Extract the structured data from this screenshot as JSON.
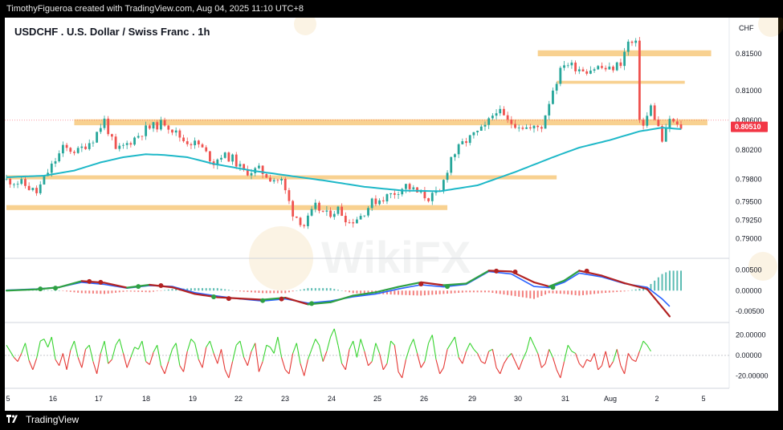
{
  "header": {
    "text": "TimothyFigueroa created with TradingView.com, Aug 04, 2025 11:10 UTC+8"
  },
  "footer": {
    "brand": "TradingView"
  },
  "watermark": {
    "text": "WikiFX"
  },
  "colors": {
    "up": "#26a69a",
    "down": "#ef5350",
    "ma": "#1eb8c8",
    "zone": "#f7c97c",
    "macd_fast": "#2962ff",
    "macd_signal_up": "#2ea043",
    "macd_signal_down": "#b22222",
    "rsi_up": "#38d430",
    "rsi_down": "#e53935",
    "price_badge": "#f23645"
  },
  "chart_data": {
    "type": "candlestick",
    "title": "USDCHF . U.S. Dollar / Swiss Franc . 1h",
    "currency": "CHF",
    "x_ticks": [
      "5",
      "16",
      "17",
      "18",
      "19",
      "22",
      "23",
      "24",
      "25",
      "26",
      "29",
      "30",
      "31",
      "Aug",
      "2",
      "5"
    ],
    "price_axis": {
      "ticks": [
        "0.81500",
        "0.81000",
        "0.80600",
        "0.80200",
        "0.79800",
        "0.79500",
        "0.79250",
        "0.79000"
      ],
      "ylim": [
        0.7882,
        0.819
      ]
    },
    "current_price": "0.80510",
    "price_path": [
      [
        0,
        0.798
      ],
      [
        5,
        0.7975
      ],
      [
        9,
        0.7962
      ],
      [
        12,
        0.799
      ],
      [
        16,
        0.8022
      ],
      [
        20,
        0.8018
      ],
      [
        24,
        0.8035
      ],
      [
        27,
        0.806
      ],
      [
        30,
        0.8018
      ],
      [
        33,
        0.8028
      ],
      [
        38,
        0.8048
      ],
      [
        43,
        0.8057
      ],
      [
        48,
        0.8033
      ],
      [
        52,
        0.8027
      ],
      [
        56,
        0.8003
      ],
      [
        58,
        0.8013
      ],
      [
        61,
        0.8008
      ],
      [
        64,
        0.799
      ],
      [
        68,
        0.7993
      ],
      [
        71,
        0.7982
      ],
      [
        74,
        0.7978
      ],
      [
        77,
        0.7935
      ],
      [
        80,
        0.7918
      ],
      [
        83,
        0.7943
      ],
      [
        86,
        0.7932
      ],
      [
        89,
        0.794
      ],
      [
        92,
        0.7922
      ],
      [
        95,
        0.7931
      ],
      [
        98,
        0.7949
      ],
      [
        101,
        0.7955
      ],
      [
        104,
        0.7962
      ],
      [
        107,
        0.7972
      ],
      [
        110,
        0.7962
      ],
      [
        113,
        0.7955
      ],
      [
        116,
        0.7962
      ],
      [
        119,
        0.801
      ],
      [
        122,
        0.8028
      ],
      [
        125,
        0.804
      ],
      [
        128,
        0.805
      ],
      [
        131,
        0.8075
      ],
      [
        134,
        0.8058
      ],
      [
        137,
        0.8054
      ],
      [
        140,
        0.8048
      ],
      [
        143,
        0.8052
      ],
      [
        146,
        0.8102
      ],
      [
        149,
        0.8138
      ],
      [
        152,
        0.8132
      ],
      [
        155,
        0.8128
      ],
      [
        158,
        0.8132
      ],
      [
        161,
        0.8128
      ],
      [
        164,
        0.8138
      ],
      [
        166,
        0.8165
      ],
      [
        168,
        0.8162
      ],
      [
        169,
        0.8065
      ],
      [
        170,
        0.8052
      ],
      [
        172,
        0.8078
      ],
      [
        174,
        0.805
      ],
      [
        175,
        0.8032
      ],
      [
        176,
        0.8045
      ],
      [
        177,
        0.8062
      ],
      [
        179,
        0.8051
      ]
    ],
    "ma_path": [
      [
        0,
        0.7983
      ],
      [
        10,
        0.7985
      ],
      [
        18,
        0.7992
      ],
      [
        25,
        0.8003
      ],
      [
        31,
        0.801
      ],
      [
        37,
        0.8014
      ],
      [
        42,
        0.8013
      ],
      [
        48,
        0.801
      ],
      [
        55,
        0.8001
      ],
      [
        65,
        0.7992
      ],
      [
        75,
        0.7985
      ],
      [
        85,
        0.7978
      ],
      [
        95,
        0.797
      ],
      [
        105,
        0.7965
      ],
      [
        115,
        0.7964
      ],
      [
        125,
        0.7972
      ],
      [
        135,
        0.799
      ],
      [
        145,
        0.801
      ],
      [
        152,
        0.8023
      ],
      [
        160,
        0.8033
      ],
      [
        168,
        0.8045
      ],
      [
        174,
        0.805
      ],
      [
        179,
        0.8048
      ]
    ],
    "zones": [
      {
        "x0": 141,
        "x1": 187,
        "y_top": 0.81545,
        "y_bot": 0.81465
      },
      {
        "x0": 146,
        "x1": 180,
        "y_top": 0.81133,
        "y_bot": 0.81093
      },
      {
        "x0": 18,
        "x1": 186,
        "y_top": 0.80612,
        "y_bot": 0.80532
      },
      {
        "x0": 0,
        "x1": 146,
        "y_top": 0.79855,
        "y_bot": 0.798
      },
      {
        "x0": 0,
        "x1": 117,
        "y_top": 0.79452,
        "y_bot": 0.79386
      }
    ],
    "macd": {
      "axis_ticks": [
        "0.00500",
        "0.00000",
        "-0.00500"
      ],
      "ylim": [
        -0.0069,
        0.007
      ],
      "fast_path": [
        [
          0,
          0.0001
        ],
        [
          8,
          0.0004
        ],
        [
          14,
          0.0008
        ],
        [
          20,
          0.002
        ],
        [
          26,
          0.0015
        ],
        [
          32,
          0.0006
        ],
        [
          38,
          0.0012
        ],
        [
          44,
          0.001
        ],
        [
          50,
          -0.0005
        ],
        [
          56,
          -0.0013
        ],
        [
          62,
          -0.002
        ],
        [
          68,
          -0.0025
        ],
        [
          74,
          -0.002
        ],
        [
          80,
          -0.003
        ],
        [
          86,
          -0.0025
        ],
        [
          92,
          -0.0015
        ],
        [
          98,
          -0.0008
        ],
        [
          104,
          0.0004
        ],
        [
          110,
          0.0014
        ],
        [
          116,
          0.0009
        ],
        [
          122,
          0.0015
        ],
        [
          128,
          0.0046
        ],
        [
          134,
          0.004
        ],
        [
          140,
          0.001
        ],
        [
          144,
          0.0007
        ],
        [
          148,
          0.002
        ],
        [
          152,
          0.0042
        ],
        [
          158,
          0.0033
        ],
        [
          164,
          0.0017
        ],
        [
          170,
          0.0008
        ],
        [
          174,
          -0.002
        ],
        [
          176,
          -0.0038
        ]
      ],
      "signal_path": [
        [
          0,
          0.0
        ],
        [
          8,
          0.0003
        ],
        [
          14,
          0.0008
        ],
        [
          20,
          0.0023
        ],
        [
          26,
          0.0019
        ],
        [
          32,
          0.0007
        ],
        [
          38,
          0.0014
        ],
        [
          44,
          0.0008
        ],
        [
          50,
          -0.0008
        ],
        [
          56,
          -0.0016
        ],
        [
          62,
          -0.0019
        ],
        [
          68,
          -0.0022
        ],
        [
          74,
          -0.0017
        ],
        [
          80,
          -0.0033
        ],
        [
          86,
          -0.0028
        ],
        [
          92,
          -0.0012
        ],
        [
          98,
          -0.0004
        ],
        [
          104,
          0.0009
        ],
        [
          110,
          0.002
        ],
        [
          116,
          0.0013
        ],
        [
          122,
          0.0017
        ],
        [
          128,
          0.0048
        ],
        [
          134,
          0.0046
        ],
        [
          140,
          0.002
        ],
        [
          144,
          0.001
        ],
        [
          148,
          0.0024
        ],
        [
          152,
          0.0048
        ],
        [
          158,
          0.0036
        ],
        [
          164,
          0.0018
        ],
        [
          170,
          0.0004
        ],
        [
          174,
          -0.004
        ],
        [
          176,
          -0.0062
        ]
      ],
      "dots": [
        {
          "x": 9,
          "v": 0.0004,
          "c": "up"
        },
        {
          "x": 13,
          "v": 0.0006,
          "c": "up"
        },
        {
          "x": 22,
          "v": 0.0022,
          "c": "down"
        },
        {
          "x": 25,
          "v": 0.002,
          "c": "down"
        },
        {
          "x": 35,
          "v": 0.001,
          "c": "up"
        },
        {
          "x": 41,
          "v": 0.0012,
          "c": "down"
        },
        {
          "x": 55,
          "v": -0.0015,
          "c": "up"
        },
        {
          "x": 59,
          "v": -0.0019,
          "c": "down"
        },
        {
          "x": 68,
          "v": -0.0024,
          "c": "up"
        },
        {
          "x": 73,
          "v": -0.002,
          "c": "down"
        },
        {
          "x": 81,
          "v": -0.0031,
          "c": "up"
        },
        {
          "x": 110,
          "v": 0.0016,
          "c": "down"
        },
        {
          "x": 117,
          "v": 0.001,
          "c": "up"
        },
        {
          "x": 130,
          "v": 0.0047,
          "c": "down"
        },
        {
          "x": 135,
          "v": 0.0045,
          "c": "down"
        },
        {
          "x": 145,
          "v": 0.0008,
          "c": "up"
        },
        {
          "x": 154,
          "v": 0.0047,
          "c": "down"
        }
      ]
    },
    "rsi": {
      "axis_ticks": [
        "20.00000",
        "0.00000",
        "-20.00000"
      ],
      "ylim": [
        -29,
        29
      ],
      "values": [
        10,
        4,
        -2,
        -6,
        2,
        12,
        -5,
        -14,
        -3,
        14,
        16,
        8,
        18,
        -4,
        -10,
        2,
        -14,
        5,
        14,
        -2,
        -12,
        6,
        10,
        -6,
        -18,
        2,
        14,
        -8,
        -4,
        10,
        16,
        2,
        -12,
        -2,
        8,
        6,
        14,
        -6,
        -9,
        3,
        10,
        -10,
        -18,
        -6,
        6,
        12,
        -10,
        -16,
        4,
        16,
        12,
        -4,
        -12,
        8,
        14,
        2,
        -8,
        6,
        -14,
        -22,
        -6,
        10,
        14,
        -2,
        -10,
        4,
        12,
        -16,
        -6,
        10,
        8,
        2,
        18,
        -2,
        -14,
        -18,
        2,
        12,
        -8,
        -20,
        -4,
        6,
        16,
        10,
        -6,
        4,
        18,
        26,
        10,
        -8,
        -14,
        6,
        14,
        -2,
        16,
        4,
        -10,
        -6,
        12,
        2,
        -14,
        -8,
        14,
        10,
        -16,
        -22,
        -4,
        8,
        16,
        2,
        -12,
        -6,
        12,
        20,
        -4,
        -18,
        -12,
        6,
        12,
        18,
        -2,
        -8,
        4,
        12,
        6,
        2,
        -6,
        -8,
        4,
        6,
        -12,
        -18,
        -8,
        -2,
        2,
        -6,
        -14,
        -4,
        4,
        18,
        10,
        2,
        -12,
        -8,
        6,
        -2,
        -14,
        -22,
        -6,
        10,
        4,
        2,
        -8,
        -12,
        -4,
        -6,
        2,
        -14,
        -10,
        4,
        -12,
        -6,
        6,
        -10,
        -18,
        2,
        -4,
        -6,
        4,
        14,
        10,
        4
      ]
    }
  }
}
